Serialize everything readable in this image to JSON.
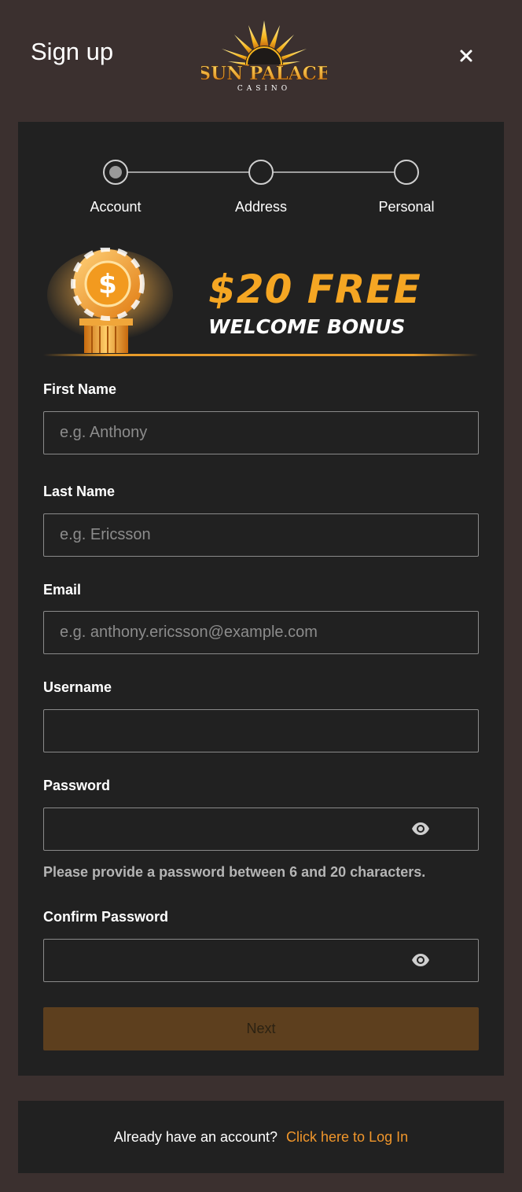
{
  "header": {
    "title": "Sign up",
    "logo_text": "SUN PALACE",
    "logo_subtext": "CASINO",
    "close_icon": "close-icon"
  },
  "stepper": {
    "steps": [
      {
        "label": "Account",
        "active": true
      },
      {
        "label": "Address",
        "active": false
      },
      {
        "label": "Personal",
        "active": false
      }
    ]
  },
  "banner": {
    "amount": "$20 FREE",
    "subtitle": "WELCOME BONUS",
    "icon": "dollar-chip-pedestal-icon"
  },
  "form": {
    "first_name": {
      "label": "First Name",
      "placeholder": "e.g. Anthony",
      "value": ""
    },
    "last_name": {
      "label": "Last Name",
      "placeholder": "e.g. Ericsson",
      "value": ""
    },
    "email": {
      "label": "Email",
      "placeholder": "e.g. anthony.ericsson@example.com",
      "value": ""
    },
    "username": {
      "label": "Username",
      "placeholder": "",
      "value": ""
    },
    "password": {
      "label": "Password",
      "placeholder": "",
      "value": "",
      "hint": "Please provide a password between 6 and 20 characters."
    },
    "confirm_password": {
      "label": "Confirm Password",
      "placeholder": "",
      "value": ""
    },
    "next_label": "Next"
  },
  "footer": {
    "question": "Already have an account?",
    "login_link": "Click here to Log In"
  },
  "colors": {
    "background": "#3b302f",
    "card": "#212121",
    "accent": "#f0962b",
    "button": "#5d3f1e"
  }
}
